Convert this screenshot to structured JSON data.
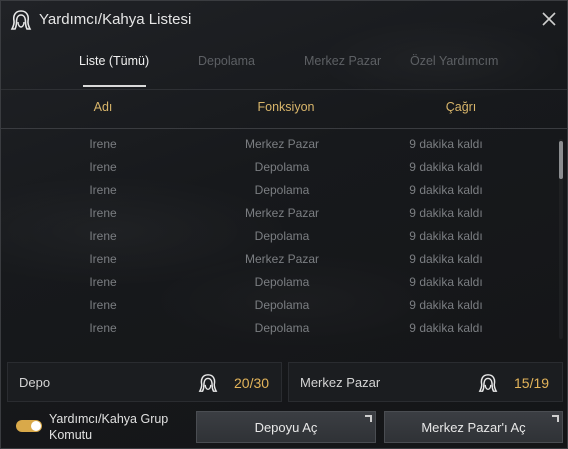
{
  "window": {
    "title": "Yardımcı/Kahya Listesi",
    "title_icon": "maid-icon",
    "close_icon": "close-icon"
  },
  "tabs": [
    {
      "label": "Liste (Tümü)",
      "active": true
    },
    {
      "label": "Depolama",
      "active": false
    },
    {
      "label": "Merkez Pazar",
      "active": false
    },
    {
      "label": "Özel Yardımcım",
      "active": false
    }
  ],
  "columns": {
    "name": "Adı",
    "function": "Fonksiyon",
    "call": "Çağrı"
  },
  "rows": [
    {
      "name": "Irene",
      "function": "Merkez Pazar",
      "call": "9 dakika kaldı"
    },
    {
      "name": "Irene",
      "function": "Depolama",
      "call": "9 dakika kaldı"
    },
    {
      "name": "Irene",
      "function": "Depolama",
      "call": "9 dakika kaldı"
    },
    {
      "name": "Irene",
      "function": "Merkez Pazar",
      "call": "9 dakika kaldı"
    },
    {
      "name": "Irene",
      "function": "Depolama",
      "call": "9 dakika kaldı"
    },
    {
      "name": "Irene",
      "function": "Merkez Pazar",
      "call": "9 dakika kaldı"
    },
    {
      "name": "Irene",
      "function": "Depolama",
      "call": "9 dakika kaldı"
    },
    {
      "name": "Irene",
      "function": "Depolama",
      "call": "9 dakika kaldı"
    },
    {
      "name": "Irene",
      "function": "Depolama",
      "call": "9 dakika kaldı"
    }
  ],
  "counts": {
    "storage": {
      "label": "Depo",
      "value": "20/30",
      "icon": "maid-icon"
    },
    "market": {
      "label": "Merkez Pazar",
      "value": "15/19",
      "icon": "maid-icon"
    }
  },
  "group_command": {
    "label": "Yardımcı/Kahya Grup Komutu",
    "enabled": true
  },
  "buttons": {
    "open_storage": "Depoyu Aç",
    "open_market": "Merkez Pazar'ı Aç"
  },
  "colors": {
    "accent_gold": "#d8b56a",
    "count_value": "#e3b45a",
    "toggle_on": "#d9a94a"
  }
}
